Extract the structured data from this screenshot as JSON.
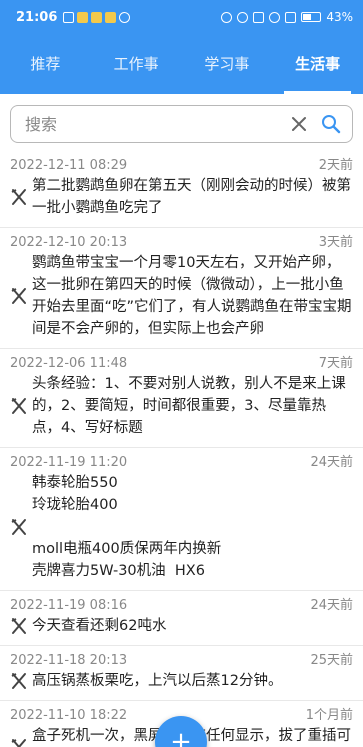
{
  "status_bar": {
    "time": "21:06",
    "battery": "43%"
  },
  "tabs": [
    {
      "label": "推荐"
    },
    {
      "label": "工作事"
    },
    {
      "label": "学习事"
    },
    {
      "label": "生活事"
    }
  ],
  "active_tab": "生活事",
  "search": {
    "placeholder": "搜索",
    "value": ""
  },
  "items": [
    {
      "date": "2022-12-11 08:29",
      "ago": "2天前",
      "text": "第二批鹦鹉鱼卵在第五天（刚刚会动的时候）被第一批小鹦鹉鱼吃完了"
    },
    {
      "date": "2022-12-10 20:13",
      "ago": "3天前",
      "text": "鹦鹉鱼带宝宝一个月零10天左右，又开始产卵，这一批卵在第四天的时候（微微动），上一批小鱼开始去里面“吃”它们了，有人说鹦鹉鱼在带宝宝期间是不会产卵的，但实际上也会产卵"
    },
    {
      "date": "2022-12-06 11:48",
      "ago": "7天前",
      "text": "头条经验：1、不要对别人说教，别人不是来上课的，2、要简短，时间都很重要，3、尽量靠热点，4、写好标题"
    },
    {
      "date": "2022-11-19 11:20",
      "ago": "24天前",
      "text": "韩泰轮胎550\n玲珑轮胎400\n\nmoll电瓶400质保两年内换新\n壳牌喜力5W-30机油  HX6"
    },
    {
      "date": "2022-11-19 08:16",
      "ago": "24天前",
      "text": "今天查看还剩62吨水"
    },
    {
      "date": "2022-11-18 20:13",
      "ago": "25天前",
      "text": "高压锅蒸板栗吃，上汽以后蒸12分钟。"
    },
    {
      "date": "2022-11-10 18:22",
      "ago": "1个月前",
      "text": "盒子死机一次，黑屏，没有任何显示，拔了重插可以了"
    }
  ],
  "fab_label": "+"
}
